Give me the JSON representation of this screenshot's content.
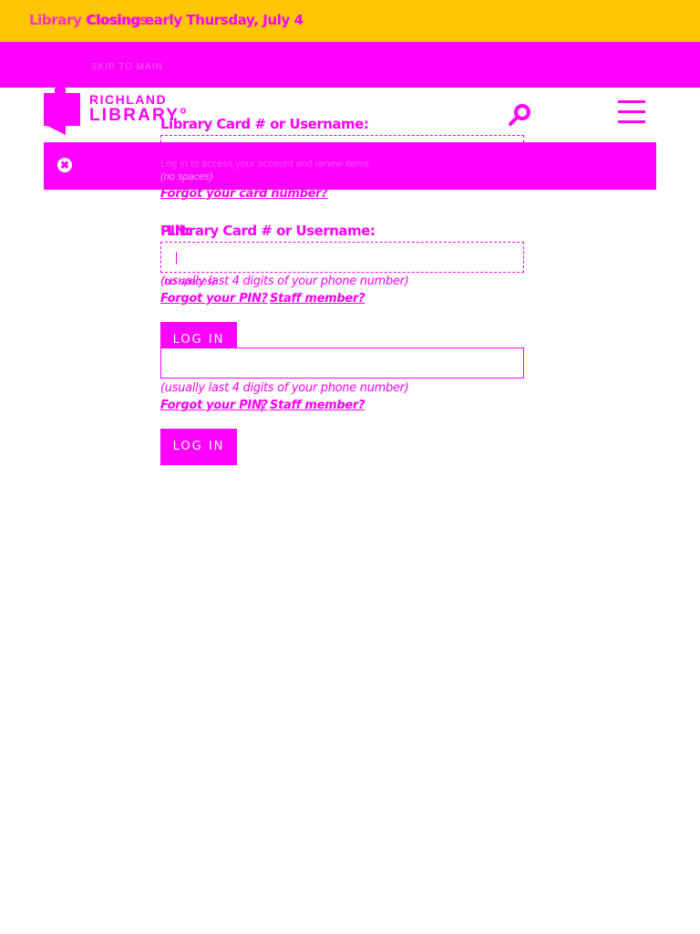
{
  "alert_bar": {
    "text": "Closing early Thursday, July 4",
    "ghost_text": "Library Closings"
  },
  "band": {
    "text": "SKIP TO MAIN"
  },
  "logo": {
    "top": "RICHLAND",
    "bottom": "LIBRARY°"
  },
  "header": {
    "search_icon": "search-icon",
    "menu_icon": "hamburger-menu-icon"
  },
  "message": {
    "close_symbol": "✖",
    "text": "Log in to access your account and renew items"
  },
  "login_form": {
    "card_label": "Library Card # or Username:",
    "card_hint": "(no spaces)",
    "forgot_card_link": "Forgot your card number?",
    "pin_label": "PIN:",
    "pin_hint": "(usually last 4 digits of your phone number)",
    "forgot_pin_link": "Forgot your PIN?",
    "separator": " | ",
    "staff_link": "Staff member?",
    "login_button": "LOG IN"
  },
  "colors": {
    "alert_background": "#ffc600",
    "accent": "#ff00ff",
    "background": "#ffffff"
  }
}
